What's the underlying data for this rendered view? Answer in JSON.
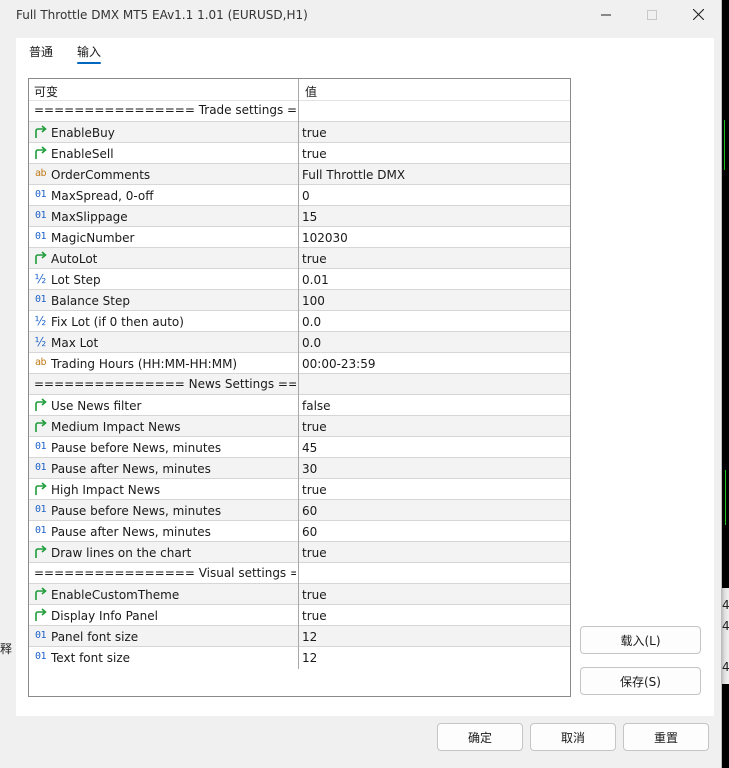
{
  "window": {
    "title": "Full Throttle DMX MT5 EAv1.1 1.01 (EURUSD,H1)",
    "minimize_icon": "minimize-icon",
    "maximize_icon": "maximize-icon",
    "close_icon": "close-icon"
  },
  "tabs": [
    {
      "label": "普通",
      "active": false
    },
    {
      "label": "输入",
      "active": true
    }
  ],
  "grid": {
    "headers": {
      "name": "可变",
      "value": "值"
    },
    "rows": [
      {
        "kind": "section",
        "name": "================ Trade settings =..."
      },
      {
        "kind": "bool",
        "name": "EnableBuy",
        "value": "true"
      },
      {
        "kind": "bool",
        "name": "EnableSell",
        "value": "true"
      },
      {
        "kind": "string",
        "name": "OrderComments",
        "value": "Full Throttle DMX"
      },
      {
        "kind": "int",
        "name": "MaxSpread, 0-off",
        "value": "0"
      },
      {
        "kind": "int",
        "name": "MaxSlippage",
        "value": "15"
      },
      {
        "kind": "int",
        "name": "MagicNumber",
        "value": "102030"
      },
      {
        "kind": "bool",
        "name": "AutoLot",
        "value": "true"
      },
      {
        "kind": "double",
        "name": "Lot Step",
        "value": "0.01"
      },
      {
        "kind": "int",
        "name": "Balance Step",
        "value": "100"
      },
      {
        "kind": "double",
        "name": "Fix Lot (if 0 then auto)",
        "value": "0.0"
      },
      {
        "kind": "double",
        "name": "Max Lot",
        "value": "0.0"
      },
      {
        "kind": "string",
        "name": "Trading Hours (HH:MM-HH:MM)",
        "value": "00:00-23:59"
      },
      {
        "kind": "section",
        "name": "=============== News Settings ==..."
      },
      {
        "kind": "bool",
        "name": "Use News filter",
        "value": "false"
      },
      {
        "kind": "bool",
        "name": "Medium Impact News",
        "value": "true"
      },
      {
        "kind": "int",
        "name": "Pause before News, minutes",
        "value": "45"
      },
      {
        "kind": "int",
        "name": "Pause after News, minutes",
        "value": "30"
      },
      {
        "kind": "bool",
        "name": "High Impact News",
        "value": "true"
      },
      {
        "kind": "int",
        "name": "Pause before News, minutes",
        "value": "60"
      },
      {
        "kind": "int",
        "name": "Pause after News, minutes",
        "value": "60"
      },
      {
        "kind": "bool",
        "name": "Draw lines on the chart",
        "value": "true"
      },
      {
        "kind": "section",
        "name": "================ Visual settings ==..."
      },
      {
        "kind": "bool",
        "name": "EnableCustomTheme",
        "value": "true"
      },
      {
        "kind": "bool",
        "name": "Display Info Panel",
        "value": "true"
      },
      {
        "kind": "int",
        "name": "Panel font size",
        "value": "12"
      },
      {
        "kind": "int",
        "name": "Text font size",
        "value": "12"
      }
    ]
  },
  "icons": {
    "int": "01",
    "string": "ab",
    "double": "½",
    "bool": "bool-arrow-icon"
  },
  "side_buttons": {
    "load": "载入(L)",
    "save": "保存(S)"
  },
  "footer_buttons": {
    "ok": "确定",
    "cancel": "取消",
    "reset": "重置"
  },
  "background": {
    "right_digits": [
      "4",
      "4",
      "4"
    ],
    "left_text": "释"
  },
  "colors": {
    "accent": "#0067c0",
    "chart_green": "#1fd21f",
    "num_icon": "#1e62c8",
    "str_icon": "#c07a15",
    "bool_icon": "#1f9d3a"
  }
}
